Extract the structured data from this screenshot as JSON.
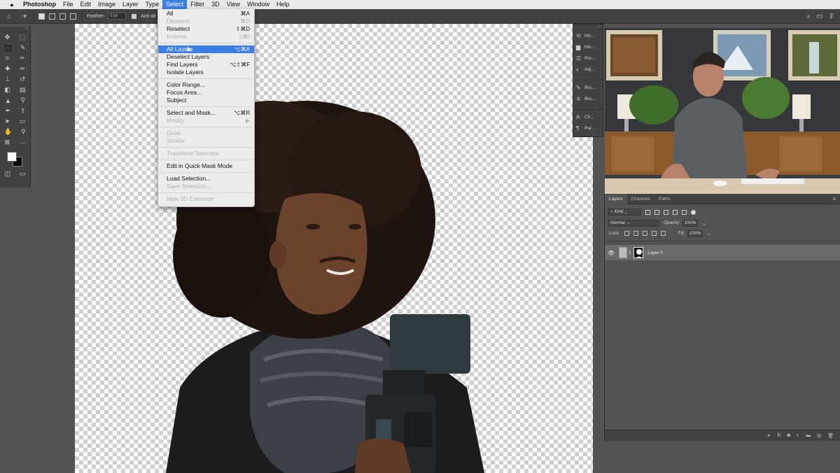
{
  "menubar": {
    "app_name": "Photoshop",
    "items": [
      "File",
      "Edit",
      "Image",
      "Layer",
      "Type",
      "Select",
      "Filter",
      "3D",
      "View",
      "Window",
      "Help"
    ],
    "active_item": "Select"
  },
  "options_bar": {
    "feather_label": "Feather:",
    "feather_value": "0 px",
    "antialias_label": "Anti-ali"
  },
  "select_menu": {
    "items": [
      {
        "label": "All",
        "shortcut": "⌘A",
        "disabled": false
      },
      {
        "label": "Deselect",
        "shortcut": "⌘D",
        "disabled": true
      },
      {
        "label": "Reselect",
        "shortcut": "⇧⌘D",
        "disabled": false
      },
      {
        "label": "Inverse",
        "shortcut": "⇧⌘I",
        "disabled": true
      },
      {
        "label": "All Layers",
        "shortcut": "⌥⌘A",
        "disabled": false,
        "highlighted": true
      },
      {
        "label": "Deselect Layers",
        "shortcut": "",
        "disabled": false
      },
      {
        "label": "Find Layers",
        "shortcut": "⌥⇧⌘F",
        "disabled": false
      },
      {
        "label": "Isolate Layers",
        "shortcut": "",
        "disabled": false
      },
      {
        "label": "Color Range...",
        "shortcut": "",
        "disabled": false
      },
      {
        "label": "Focus Area...",
        "shortcut": "",
        "disabled": false
      },
      {
        "label": "Subject",
        "shortcut": "",
        "disabled": false
      },
      {
        "label": "Select and Mask...",
        "shortcut": "⌥⌘R",
        "disabled": false
      },
      {
        "label": "Modify",
        "shortcut": "▶",
        "disabled": true
      },
      {
        "label": "Grow",
        "shortcut": "",
        "disabled": true
      },
      {
        "label": "Similar",
        "shortcut": "",
        "disabled": true
      },
      {
        "label": "Transform Selection",
        "shortcut": "",
        "disabled": true
      },
      {
        "label": "Edit in Quick Mask Mode",
        "shortcut": "",
        "disabled": false
      },
      {
        "label": "Load Selection...",
        "shortcut": "",
        "disabled": false
      },
      {
        "label": "Save Selection...",
        "shortcut": "",
        "disabled": true
      },
      {
        "label": "New 3D Extrusion",
        "shortcut": "",
        "disabled": true
      }
    ]
  },
  "side_panels": [
    {
      "label": "His...",
      "icon": "history-icon"
    },
    {
      "label": "His...",
      "icon": "histogram-icon"
    },
    {
      "label": "Pro...",
      "icon": "properties-icon"
    },
    {
      "label": "Adj...",
      "icon": "adjustments-icon"
    },
    {
      "label": "Bru...",
      "icon": "brush-icon"
    },
    {
      "label": "Bru...",
      "icon": "brush-settings-icon"
    },
    {
      "label": "Ch...",
      "icon": "character-icon"
    },
    {
      "label": "Par...",
      "icon": "paragraph-icon"
    }
  ],
  "layers_panel": {
    "tabs": [
      "Layers",
      "Channels",
      "Paths"
    ],
    "active_tab": "Layers",
    "filter_kind": "Kind",
    "blend_mode": "Normal",
    "opacity_label": "Opacity:",
    "opacity_value": "100%",
    "lock_label": "Lock:",
    "fill_label": "Fill:",
    "fill_value": "100%",
    "layers": [
      {
        "name": "Layer 0",
        "visible": true,
        "has_mask": true,
        "selected": true
      }
    ],
    "footer_icons": [
      "link-icon",
      "fx-icon",
      "mask-icon",
      "adjustment-layer-icon",
      "group-icon",
      "new-layer-icon",
      "trash-icon"
    ],
    "footer_fx": "fx"
  },
  "colors": {
    "accent": "#3b7ee6",
    "panel": "#535353",
    "panel_dark": "#424242",
    "menu_bg": "#ececec"
  }
}
